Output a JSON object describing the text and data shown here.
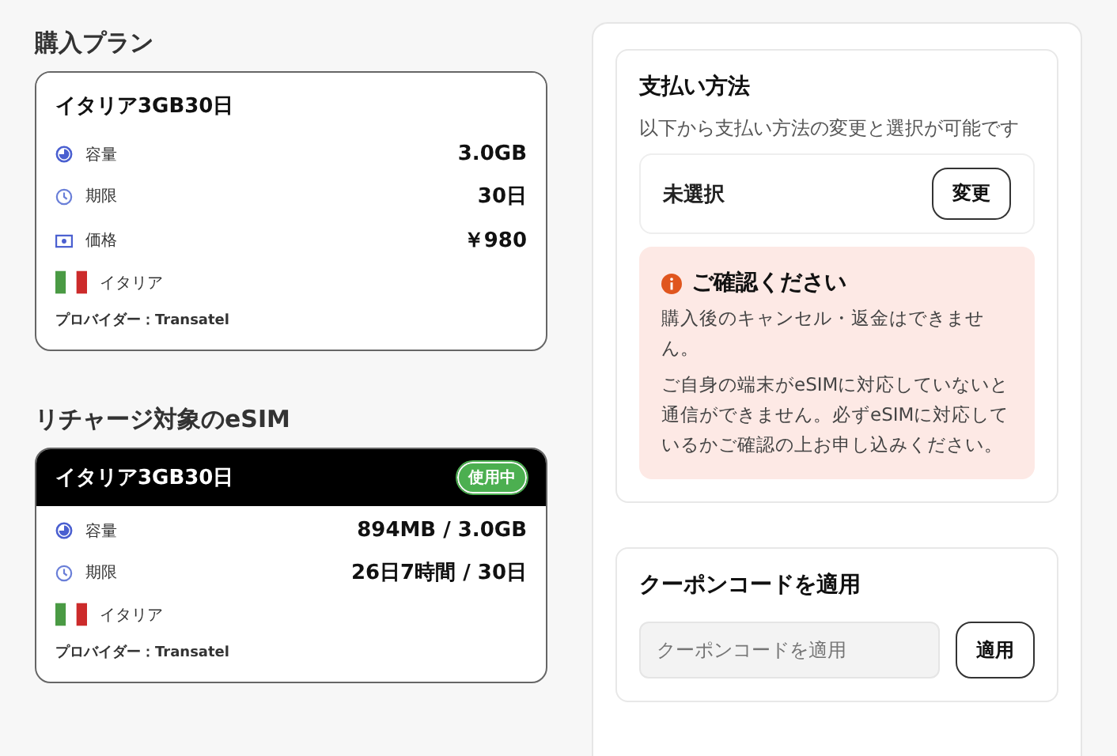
{
  "purchase_plan": {
    "heading": "購入プラン",
    "card": {
      "title": "イタリア3GB30日",
      "rows": [
        {
          "kind": "data",
          "label": "容量",
          "value": "3.0GB"
        },
        {
          "kind": "clock",
          "label": "期限",
          "value": "30日"
        },
        {
          "kind": "price",
          "label": "価格",
          "value": "￥980"
        }
      ],
      "country": "イタリア",
      "provider": "プロバイダー：Transatel"
    }
  },
  "recharge_esim": {
    "heading": "リチャージ対象のeSIM",
    "card": {
      "title": "イタリア3GB30日",
      "badge": "使用中",
      "rows": [
        {
          "kind": "data",
          "label": "容量",
          "value": "894MB / 3.0GB"
        },
        {
          "kind": "clock",
          "label": "期限",
          "value": "26日7時間 / 30日"
        }
      ],
      "country": "イタリア",
      "provider": "プロバイダー：Transatel"
    }
  },
  "payment": {
    "title": "支払い方法",
    "description": "以下から支払い方法の変更と選択が可能です",
    "method": "未選択",
    "change_button": "変更",
    "notice": {
      "title": "ご確認ください",
      "lines": [
        "購入後のキャンセル・返金はできません。",
        "ご自身の端末がeSIMに対応していないと通信ができません。必ずeSIMに対応しているかご確認の上お申し込みください。"
      ]
    }
  },
  "coupon": {
    "title": "クーポンコードを適用",
    "placeholder": "クーポンコードを適用",
    "button": "適用"
  }
}
